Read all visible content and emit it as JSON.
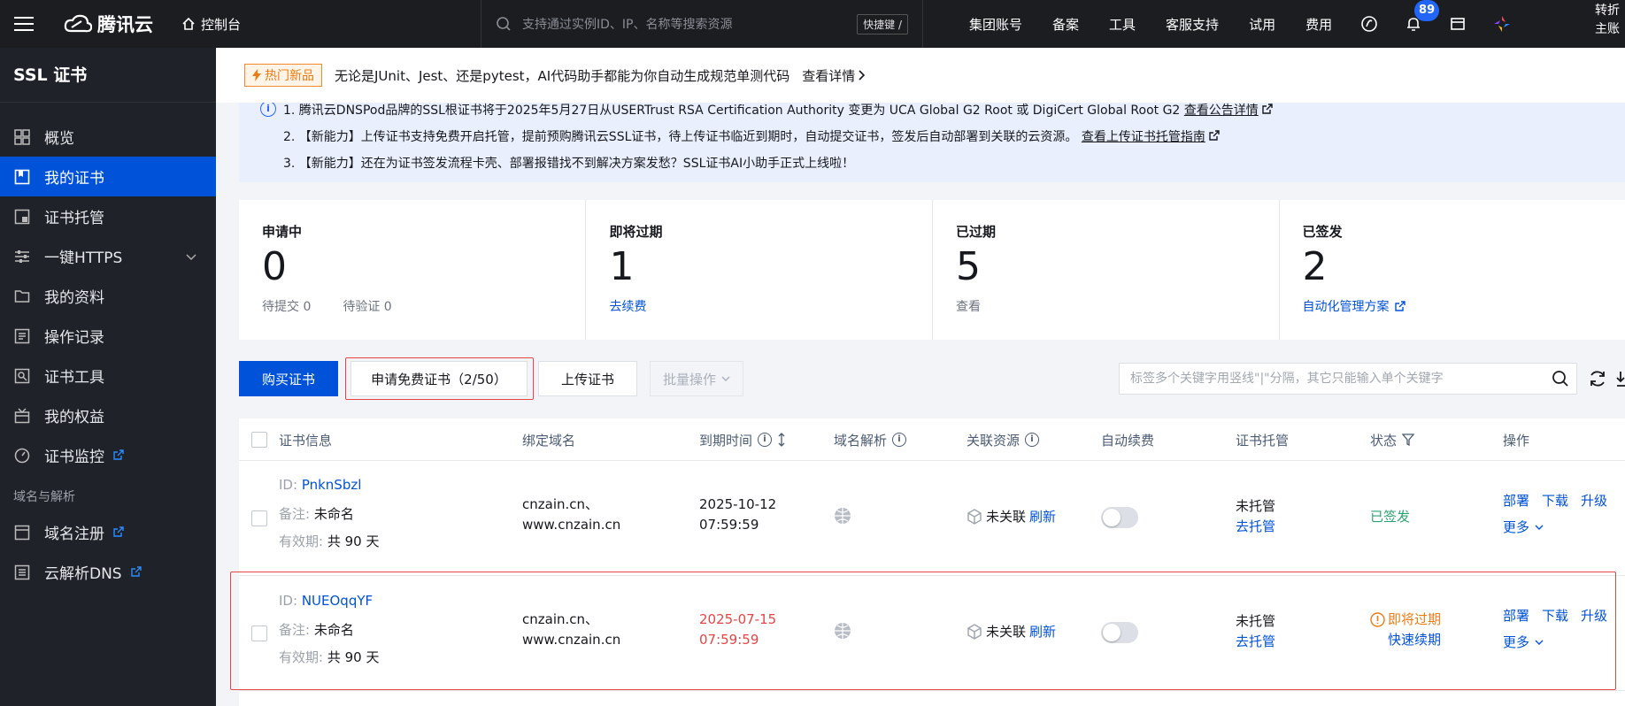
{
  "topbar": {
    "brand": "腾讯云",
    "console": "控制台",
    "search_placeholder": "支持通过实例ID、IP、名称等搜索资源",
    "shortcut": "快捷键 /",
    "nav": [
      "集团账号",
      "备案",
      "工具",
      "客服支持",
      "试用",
      "费用"
    ],
    "notification_count": "89",
    "account_line1": "转折",
    "account_line2": "主账"
  },
  "sidebar": {
    "title": "SSL 证书",
    "items": [
      {
        "label": "概览",
        "icon": "grid-icon"
      },
      {
        "label": "我的证书",
        "icon": "certificate-icon"
      },
      {
        "label": "证书托管",
        "icon": "hosting-icon"
      },
      {
        "label": "一键HTTPS",
        "icon": "sliders-icon"
      },
      {
        "label": "我的资料",
        "icon": "folder-icon"
      },
      {
        "label": "操作记录",
        "icon": "log-icon"
      },
      {
        "label": "证书工具",
        "icon": "tool-icon"
      },
      {
        "label": "我的权益",
        "icon": "gift-icon"
      },
      {
        "label": "证书监控",
        "icon": "monitor-icon"
      }
    ],
    "group_label": "域名与解析",
    "group_items": [
      {
        "label": "域名注册",
        "icon": "domain-icon"
      },
      {
        "label": "云解析DNS",
        "icon": "dns-icon"
      }
    ]
  },
  "promo": {
    "tag": "热门新品",
    "text": "无论是JUnit、Jest、还是pytest，AI代码助手都能为你自动生成规范单测代码",
    "link": "查看详情"
  },
  "notice": {
    "line1": "1. 腾讯云DNSPod品牌的SSL根证书将于2025年5月27日从USERTrust RSA Certification Authority 变更为 UCA Global G2 Root 或 DigiCert Global Root G2",
    "line1_link": "查看公告详情",
    "line2": "2. 【新能力】上传证书支持免费开启托管，提前预购腾讯云SSL证书，待上传证书临近到期时，自动提交证书，签发后自动部署到关联的云资源。",
    "line2_link": "查看上传证书托管指南",
    "line3": "3. 【新能力】还在为证书签发流程卡壳、部署报错找不到解决方案发愁？SSL证书AI小助手正式上线啦！"
  },
  "stats": [
    {
      "label": "申请中",
      "value": "0",
      "sub1": "待提交 0",
      "sub2": "待验证 0"
    },
    {
      "label": "即将过期",
      "value": "1",
      "link": "去续费"
    },
    {
      "label": "已过期",
      "value": "5",
      "link": "查看"
    },
    {
      "label": "已签发",
      "value": "2",
      "link": "自动化管理方案"
    }
  ],
  "toolbar": {
    "buy": "购买证书",
    "apply_free": "申请免费证书（2/50）",
    "upload": "上传证书",
    "batch": "批量操作",
    "search_placeholder": "标签多个关键字用竖线\"|\"分隔，其它只能输入单个关键字"
  },
  "table": {
    "headers": [
      "证书信息",
      "绑定域名",
      "到期时间",
      "域名解析",
      "关联资源",
      "自动续费",
      "证书托管",
      "状态",
      "操作"
    ],
    "id_label": "ID:",
    "remark_label": "备注:",
    "validity_label": "有效期:",
    "rows": [
      {
        "id": "PnknSbzl",
        "remark": "未命名",
        "validity": "共 90 天",
        "domain1": "cnzain.cn、",
        "domain2": "www.cnzain.cn",
        "expire_date": "2025-10-12",
        "expire_time": "07:59:59",
        "resource": "未关联",
        "refresh": "刷新",
        "hosting": "未托管",
        "hosting_link": "去托管",
        "status": "已签发",
        "actions": [
          "部署",
          "下载",
          "升级"
        ],
        "more": "更多"
      },
      {
        "id": "NUEOqqYF",
        "remark": "未命名",
        "validity": "共 90 天",
        "domain1": "cnzain.cn、",
        "domain2": "www.cnzain.cn",
        "expire_date": "2025-07-15",
        "expire_time": "07:59:59",
        "resource": "未关联",
        "refresh": "刷新",
        "hosting": "未托管",
        "hosting_link": "去托管",
        "status": "即将过期",
        "status_link": "快速续期",
        "actions": [
          "部署",
          "下载",
          "升级"
        ],
        "more": "更多"
      }
    ]
  },
  "colors": {
    "brand_blue": "#0052d9",
    "topbar_bg": "#1b1d21",
    "sidebar_bg": "#1f2228",
    "highlight_red": "#e54545",
    "success_green": "#2ba471",
    "warning_orange": "#ed7b14"
  }
}
